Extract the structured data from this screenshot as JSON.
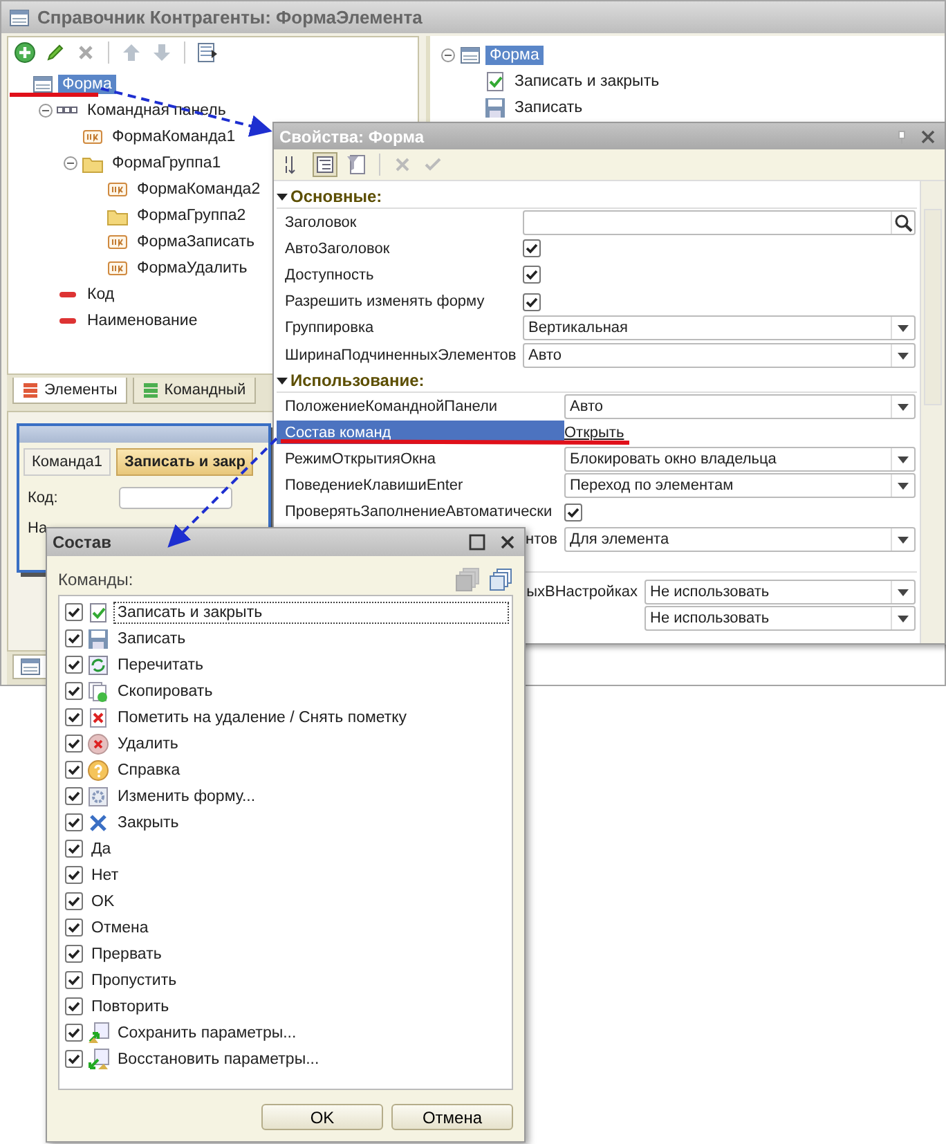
{
  "main_window": {
    "title": "Справочник Контрагенты: ФормаЭлемента",
    "elements_tree": [
      {
        "label": "Форма",
        "kind": "form",
        "selected": true,
        "children": [
          {
            "label": "Командная панель",
            "kind": "panel",
            "selected": false,
            "expanded": true,
            "children": [
              {
                "label": "ФормаКоманда1",
                "kind": "command",
                "selected": false
              },
              {
                "label": "ФормаГруппа1",
                "kind": "folder",
                "selected": false,
                "expanded": true,
                "children": [
                  {
                    "label": "ФормаКоманда2",
                    "kind": "command",
                    "selected": false
                  },
                  {
                    "label": "ФормаГруппа2",
                    "kind": "folder",
                    "selected": false
                  },
                  {
                    "label": "ФормаЗаписать",
                    "kind": "command",
                    "selected": false
                  },
                  {
                    "label": "ФормаУдалить",
                    "kind": "command",
                    "selected": false
                  }
                ]
              }
            ]
          },
          {
            "label": "Код",
            "kind": "field",
            "selected": false
          },
          {
            "label": "Наименование",
            "kind": "field",
            "selected": false
          }
        ]
      }
    ],
    "pane_tabs": [
      {
        "label": "Элементы",
        "kind": "elements",
        "selected": true
      },
      {
        "label": "Командный",
        "kind": "commands",
        "selected": false
      }
    ],
    "preview": {
      "buttons": [
        {
          "label": "Команда1",
          "default": false
        },
        {
          "label": "Записать и закр",
          "default": true
        }
      ],
      "fields": [
        {
          "label": "Код:"
        },
        {
          "label": "На"
        }
      ]
    },
    "commands_tree": [
      {
        "label": "Форма",
        "kind": "form",
        "selected": true,
        "expanded": true,
        "children": [
          {
            "label": "Записать и закрыть",
            "kind": "save-close",
            "selected": false
          },
          {
            "label": "Записать",
            "kind": "save",
            "selected": false
          }
        ]
      }
    ]
  },
  "properties": {
    "title": "Свойства: Форма",
    "groups": [
      {
        "title": "Основные:",
        "kind": "main",
        "expanded": true,
        "rows": [
          {
            "label": "Заголовок",
            "kind": "search",
            "selected": false
          },
          {
            "label": "АвтоЗаголовок",
            "kind": "check",
            "checked": true,
            "selected": false
          },
          {
            "label": "Доступность",
            "kind": "check",
            "checked": true,
            "selected": false
          },
          {
            "label": "Разрешить изменять форму",
            "kind": "check",
            "checked": true,
            "selected": false
          },
          {
            "label": "Группировка",
            "kind": "select",
            "value": "Вертикальная",
            "selected": false
          },
          {
            "label": "ШиринаПодчиненныхЭлементов",
            "kind": "select",
            "value": "Авто",
            "selected": false
          }
        ]
      },
      {
        "title": "Использование:",
        "kind": "usage",
        "expanded": true,
        "rows": [
          {
            "label": "ПоложениеКоманднойПанели",
            "kind": "select",
            "value": "Авто",
            "selected": false
          },
          {
            "label": "Состав команд",
            "kind": "link",
            "value": "Открыть",
            "selected": true
          },
          {
            "label": "РежимОткрытияОкна",
            "kind": "select",
            "value": "Блокировать окно владельца",
            "selected": false
          },
          {
            "label": "ПоведениеКлавишиEnter",
            "kind": "select",
            "value": "Переход по элементам",
            "selected": false
          },
          {
            "label": "ПроверятьЗаполнениеАвтоматически",
            "kind": "check",
            "checked": true,
            "selected": false
          },
          {
            "label": "нтов",
            "label_covered": true,
            "kind": "select",
            "value": "Для элемента",
            "selected": false
          }
        ]
      },
      {
        "kind": "settings",
        "rows": [
          {
            "label": "ыхВНастройках",
            "label_covered": true,
            "kind": "select",
            "value": "Не использовать",
            "selected": false
          },
          {
            "kind": "select",
            "value": "Не использовать",
            "selected": false
          }
        ]
      }
    ]
  },
  "composition": {
    "title": "Состав",
    "list_label": "Команды:",
    "items": [
      {
        "label": "Записать и закрыть",
        "kind": "save-close",
        "checked": true,
        "selected": true
      },
      {
        "label": "Записать",
        "kind": "save",
        "checked": true,
        "selected": false
      },
      {
        "label": "Перечитать",
        "kind": "reread",
        "checked": true,
        "selected": false
      },
      {
        "label": "Скопировать",
        "kind": "copy",
        "checked": true,
        "selected": false
      },
      {
        "label": "Пометить на удаление / Снять пометку",
        "kind": "mark-delete",
        "checked": true,
        "selected": false
      },
      {
        "label": "Удалить",
        "kind": "delete",
        "checked": true,
        "selected": false
      },
      {
        "label": "Справка",
        "kind": "help",
        "checked": true,
        "selected": false
      },
      {
        "label": "Изменить форму...",
        "kind": "edit-form",
        "checked": true,
        "selected": false
      },
      {
        "label": "Закрыть",
        "kind": "close",
        "checked": true,
        "selected": false
      },
      {
        "label": "Да",
        "kind": "plain",
        "checked": true,
        "selected": false
      },
      {
        "label": "Нет",
        "kind": "plain",
        "checked": true,
        "selected": false
      },
      {
        "label": "OK",
        "kind": "plain",
        "checked": true,
        "selected": false
      },
      {
        "label": "Отмена",
        "kind": "plain",
        "checked": true,
        "selected": false
      },
      {
        "label": "Прервать",
        "kind": "plain",
        "checked": true,
        "selected": false
      },
      {
        "label": "Пропустить",
        "kind": "plain",
        "checked": true,
        "selected": false
      },
      {
        "label": "Повторить",
        "kind": "plain",
        "checked": true,
        "selected": false
      },
      {
        "label": "Сохранить параметры...",
        "kind": "save-params",
        "checked": true,
        "selected": false
      },
      {
        "label": "Восстановить параметры...",
        "kind": "restore-params",
        "checked": true,
        "selected": false
      }
    ],
    "buttons": [
      "OK",
      "Отмена"
    ]
  }
}
